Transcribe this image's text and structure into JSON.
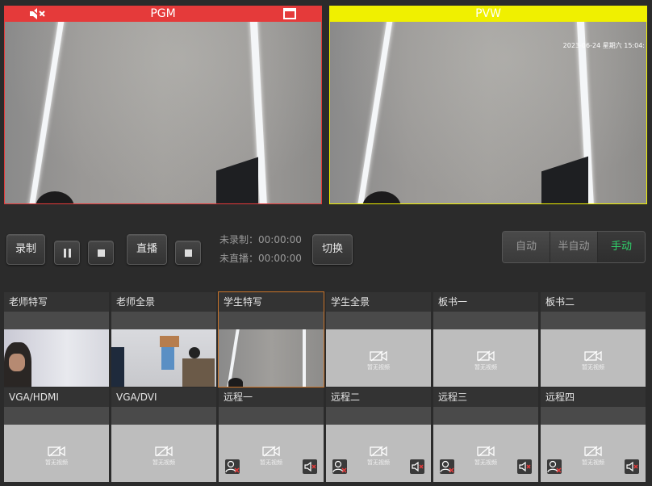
{
  "pgm": {
    "label": "PGM",
    "accent": "#e53a3a"
  },
  "pvw": {
    "label": "PVW",
    "accent": "#f0f000",
    "timestamp": "2023-06-24 星期六 15:04:"
  },
  "controls": {
    "record_label": "录制",
    "live_label": "直播",
    "switch_label": "切换",
    "record_status": "未录制：00:00:00",
    "live_status": "未直播：00:00:00"
  },
  "modes": {
    "auto": "自动",
    "semi": "半自动",
    "manual": "手动",
    "selected": "manual",
    "selected_color": "#2fd36b"
  },
  "sources": [
    {
      "title": "老师特写",
      "state": "video"
    },
    {
      "title": "老师全景",
      "state": "video"
    },
    {
      "title": "学生特写",
      "state": "video",
      "active": true
    },
    {
      "title": "学生全景",
      "state": "none"
    },
    {
      "title": "板书一",
      "state": "none"
    },
    {
      "title": "板书二",
      "state": "none"
    },
    {
      "title": "VGA/HDMI",
      "state": "none"
    },
    {
      "title": "VGA/DVI",
      "state": "none"
    },
    {
      "title": "远程一",
      "state": "none",
      "remote": true
    },
    {
      "title": "远程二",
      "state": "none",
      "remote": true
    },
    {
      "title": "远程三",
      "state": "none",
      "remote": true
    },
    {
      "title": "远程四",
      "state": "none",
      "remote": true
    }
  ],
  "no_video_text": "暂无视频",
  "icons": {
    "mute": "speaker-muted-icon",
    "fullscreen": "fullscreen-icon",
    "no_video": "camera-off-icon",
    "participant": "user-remove-icon",
    "audio": "speaker-muted-icon"
  }
}
